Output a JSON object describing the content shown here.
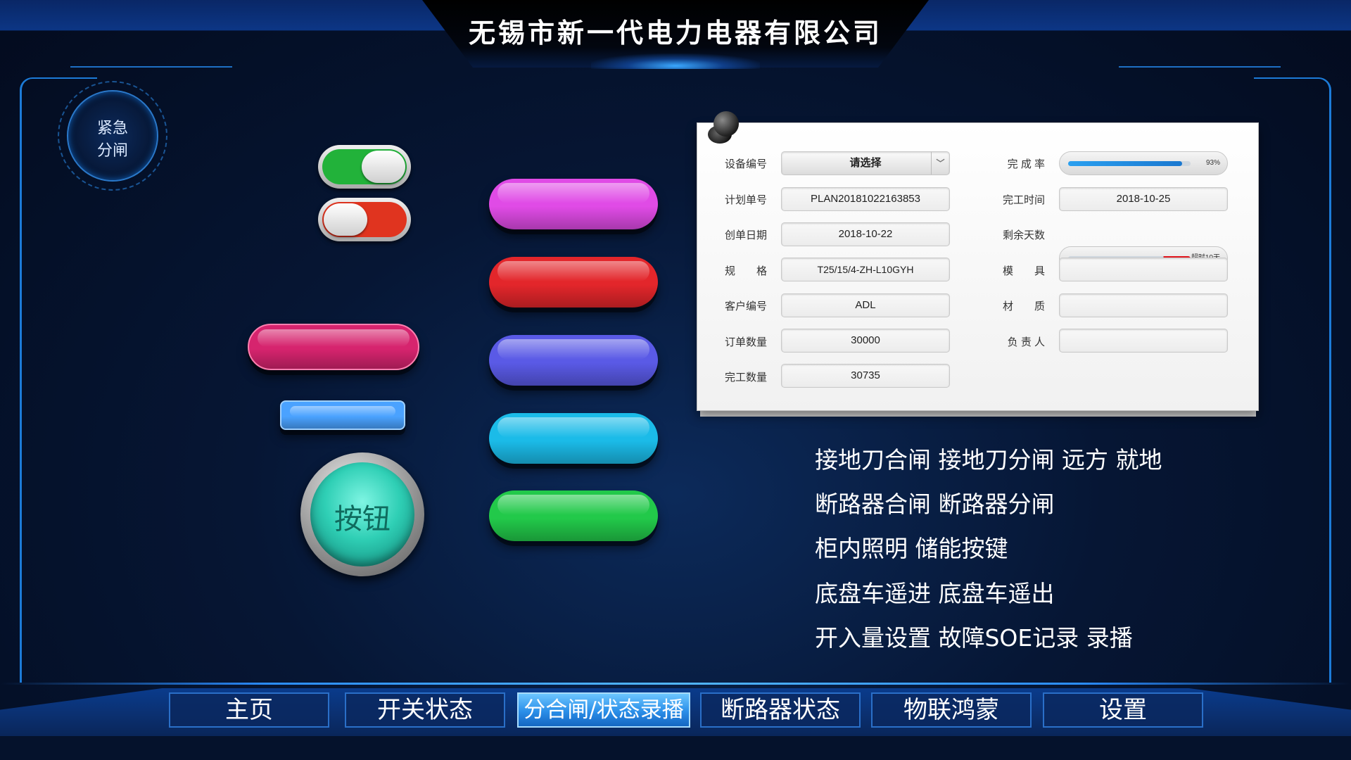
{
  "header": {
    "title": "无锡市新一代电力电器有限公司"
  },
  "emergency": {
    "line1": "紧急",
    "line2": "分闸"
  },
  "toggles": [
    {
      "state": "on",
      "color": "#22b23a"
    },
    {
      "state": "off",
      "color": "#e0341f"
    }
  ],
  "pill_buttons": {
    "magenta": "#e04be6",
    "red": "#e3262b",
    "purple": "#5a5ae6",
    "cyan": "#1bbbe8",
    "green": "#22c94a",
    "pink": "#d6246e",
    "blue": "#4aa2ff"
  },
  "round_button": {
    "label": "按钮"
  },
  "form": {
    "left": [
      {
        "label": "设备编号",
        "value": "请选择",
        "type": "select"
      },
      {
        "label": "计划单号",
        "value": "PLAN20181022163853"
      },
      {
        "label": "创单日期",
        "value": "2018-10-22"
      },
      {
        "label": "规　　格",
        "value": "T25/15/4-ZH-L10GYH"
      },
      {
        "label": "客户编号",
        "value": "ADL"
      },
      {
        "label": "订单数量",
        "value": "30000"
      },
      {
        "label": "完工数量",
        "value": "30735"
      }
    ],
    "right": {
      "completion": {
        "label": "完 成 率",
        "value_text": "93%",
        "fraction": 0.93
      },
      "finish_time": {
        "label": "完工时间",
        "value": "2018-10-25"
      },
      "remaining": {
        "label": "剩余天数",
        "value_text": "超时10天",
        "fraction": 1.0
      },
      "mold": {
        "label": "模　　具",
        "value": ""
      },
      "material": {
        "label": "材　　质",
        "value": ""
      },
      "owner": {
        "label": "负 责 人",
        "value": ""
      }
    }
  },
  "commands": [
    "接地刀合闸 接地刀分闸 远方 就地",
    "断路器合闸 断路器分闸",
    "柜内照明 储能按键",
    "底盘车遥进 底盘车遥出",
    "开入量设置 故障SOE记录 录播"
  ],
  "nav": [
    {
      "label": "主页",
      "active": false
    },
    {
      "label": "开关状态",
      "active": false
    },
    {
      "label": "分合闸/状态录播",
      "active": true
    },
    {
      "label": "断路器状态",
      "active": false
    },
    {
      "label": "物联鸿蒙",
      "active": false
    },
    {
      "label": "设置",
      "active": false
    }
  ]
}
